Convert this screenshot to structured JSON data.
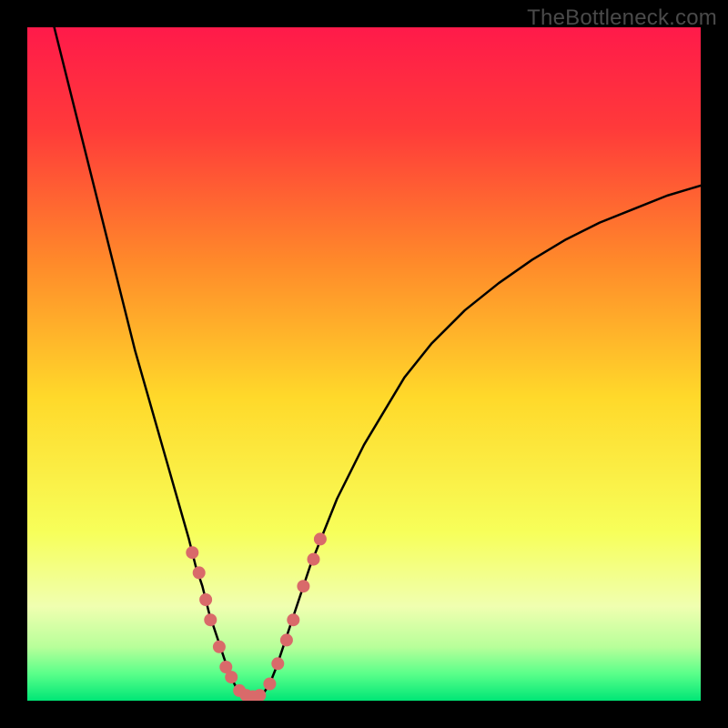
{
  "watermark": "TheBottleneck.com",
  "chart_data": {
    "type": "line",
    "title": "",
    "xlabel": "",
    "ylabel": "",
    "xlim": [
      0,
      100
    ],
    "ylim": [
      0,
      100
    ],
    "background_gradient": {
      "stops": [
        {
          "offset": 0.0,
          "color": "#ff1a4a"
        },
        {
          "offset": 0.15,
          "color": "#ff3a3a"
        },
        {
          "offset": 0.35,
          "color": "#ff8a2a"
        },
        {
          "offset": 0.55,
          "color": "#ffd92a"
        },
        {
          "offset": 0.75,
          "color": "#f7ff5a"
        },
        {
          "offset": 0.86,
          "color": "#f0ffb0"
        },
        {
          "offset": 0.92,
          "color": "#b8ff9a"
        },
        {
          "offset": 0.96,
          "color": "#5aff8a"
        },
        {
          "offset": 1.0,
          "color": "#00e676"
        }
      ]
    },
    "series": [
      {
        "name": "curve",
        "color": "#000000",
        "width": 2.5,
        "points": [
          {
            "x": 4,
            "y": 100
          },
          {
            "x": 6,
            "y": 92
          },
          {
            "x": 8,
            "y": 84
          },
          {
            "x": 10,
            "y": 76
          },
          {
            "x": 12,
            "y": 68
          },
          {
            "x": 14,
            "y": 60
          },
          {
            "x": 16,
            "y": 52
          },
          {
            "x": 18,
            "y": 45
          },
          {
            "x": 20,
            "y": 38
          },
          {
            "x": 22,
            "y": 31
          },
          {
            "x": 24,
            "y": 24
          },
          {
            "x": 25,
            "y": 20
          },
          {
            "x": 26,
            "y": 17
          },
          {
            "x": 27,
            "y": 13
          },
          {
            "x": 28,
            "y": 10
          },
          {
            "x": 29,
            "y": 7
          },
          {
            "x": 30,
            "y": 4
          },
          {
            "x": 31,
            "y": 2
          },
          {
            "x": 32,
            "y": 1
          },
          {
            "x": 33,
            "y": 0.5
          },
          {
            "x": 34,
            "y": 0.5
          },
          {
            "x": 35,
            "y": 1
          },
          {
            "x": 36,
            "y": 2.5
          },
          {
            "x": 37,
            "y": 5
          },
          {
            "x": 38,
            "y": 8
          },
          {
            "x": 39,
            "y": 11
          },
          {
            "x": 40,
            "y": 14
          },
          {
            "x": 42,
            "y": 20
          },
          {
            "x": 44,
            "y": 25
          },
          {
            "x": 46,
            "y": 30
          },
          {
            "x": 48,
            "y": 34
          },
          {
            "x": 50,
            "y": 38
          },
          {
            "x": 53,
            "y": 43
          },
          {
            "x": 56,
            "y": 48
          },
          {
            "x": 60,
            "y": 53
          },
          {
            "x": 65,
            "y": 58
          },
          {
            "x": 70,
            "y": 62
          },
          {
            "x": 75,
            "y": 65.5
          },
          {
            "x": 80,
            "y": 68.5
          },
          {
            "x": 85,
            "y": 71
          },
          {
            "x": 90,
            "y": 73
          },
          {
            "x": 95,
            "y": 75
          },
          {
            "x": 100,
            "y": 76.5
          }
        ]
      }
    ],
    "markers": {
      "color": "#d96a6a",
      "radius": 7,
      "points": [
        {
          "x": 24.5,
          "y": 22
        },
        {
          "x": 25.5,
          "y": 19
        },
        {
          "x": 26.5,
          "y": 15
        },
        {
          "x": 27.2,
          "y": 12
        },
        {
          "x": 28.5,
          "y": 8
        },
        {
          "x": 29.5,
          "y": 5
        },
        {
          "x": 30.3,
          "y": 3.5
        },
        {
          "x": 31.5,
          "y": 1.5
        },
        {
          "x": 32.5,
          "y": 0.8
        },
        {
          "x": 33.5,
          "y": 0.6
        },
        {
          "x": 34.5,
          "y": 0.8
        },
        {
          "x": 36.0,
          "y": 2.5
        },
        {
          "x": 37.2,
          "y": 5.5
        },
        {
          "x": 38.5,
          "y": 9
        },
        {
          "x": 39.5,
          "y": 12
        },
        {
          "x": 41.0,
          "y": 17
        },
        {
          "x": 42.5,
          "y": 21
        },
        {
          "x": 43.5,
          "y": 24
        }
      ]
    }
  }
}
